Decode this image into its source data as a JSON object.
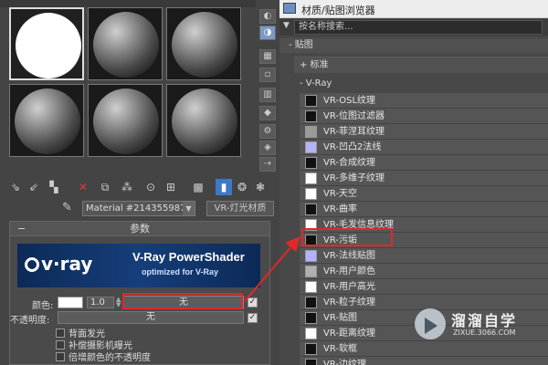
{
  "material_editor": {
    "toolbar_icons": [
      "ray-pick-icon",
      "assign-icon",
      "reset-icon",
      "delete-icon",
      "copy-icon",
      "unique-icon",
      "material-id-icon",
      "show-map-icon",
      "show-bg-icon",
      "show-end-icon",
      "go-to-parent-icon",
      "go-forward-icon"
    ],
    "side_icons": [
      "sample-type-icon",
      "backlight-icon",
      "background-icon",
      "uv-tile-icon",
      "video-check-icon",
      "make-preview-icon",
      "options-icon",
      "select-by-material-icon",
      "material-navigator-icon"
    ],
    "material_name": "Material #2143559871",
    "material_type": "VR-灯光材质",
    "rollout_title": "参数",
    "banner_title": "V-Ray PowerShader",
    "banner_subtitle": "optimized for V-Ray",
    "vray_logo": "v·ray",
    "color_label": "颜色:",
    "color_multiplier": "1.0",
    "color_map_button": "无",
    "opacity_label": "不透明度:",
    "opacity_map_button": "无",
    "options": [
      "背面发光",
      "补偿摄影机曝光",
      "倍增颜色的不透明度"
    ]
  },
  "browser": {
    "title": "材质/贴图浏览器",
    "search_placeholder": "按名称搜索...",
    "category_maps": "- 贴图",
    "category_standard": "+ 标准",
    "category_vray": "- V-Ray",
    "items": [
      {
        "name": "VR-OSL纹理",
        "swatch": "#111111"
      },
      {
        "name": "VR-位图过滤器",
        "swatch": "#111111"
      },
      {
        "name": "VR-菲涅耳纹理",
        "swatch": "#9a9a9a"
      },
      {
        "name": "VR-凹凸2法线",
        "swatch": "#b3b3ff"
      },
      {
        "name": "VR-合成纹理",
        "swatch": "#111111"
      },
      {
        "name": "VR-多维子纹理",
        "swatch": "#ffffff"
      },
      {
        "name": "VR-天空",
        "swatch": "#ffffff"
      },
      {
        "name": "VR-曲率",
        "swatch": "#111111"
      },
      {
        "name": "VR-毛发信息纹理",
        "swatch": "#ffffff"
      },
      {
        "name": "VR-污垢",
        "swatch": "#111111"
      },
      {
        "name": "VR-法线贴图",
        "swatch": "#b3b3ff"
      },
      {
        "name": "VR-用户颜色",
        "swatch": "#b0b0b0"
      },
      {
        "name": "VR-用户高光",
        "swatch": "#ffffff"
      },
      {
        "name": "VR-粒子纹理",
        "swatch": "#111111"
      },
      {
        "name": "VR-贴图",
        "swatch": "#111111"
      },
      {
        "name": "VR-距离纹理",
        "swatch": "#ffffff"
      },
      {
        "name": "VR-软框",
        "swatch": "#111111"
      },
      {
        "name": "VR-边纹理",
        "swatch": "#111111"
      }
    ]
  },
  "watermark": {
    "name": "溜溜自学",
    "url": "ZIXUE.3066.COM"
  },
  "colors": {
    "highlight": "#e0282a",
    "banner": "#163e7a"
  }
}
